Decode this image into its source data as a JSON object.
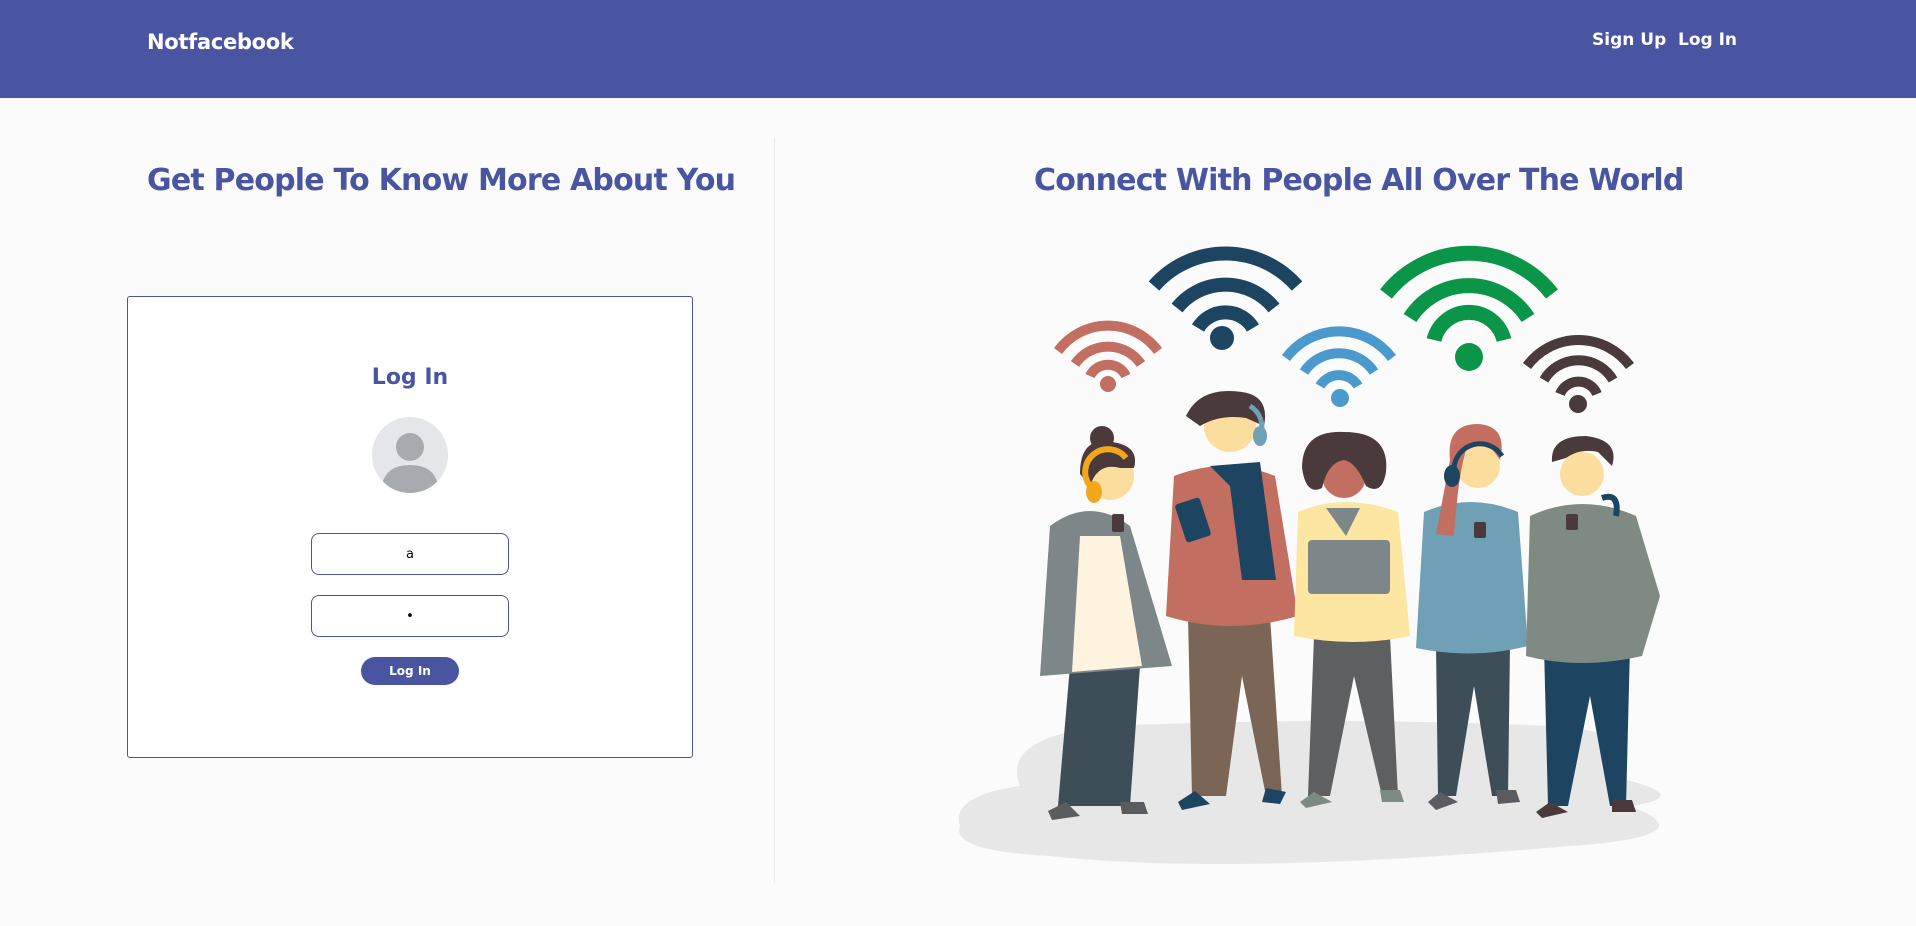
{
  "navbar": {
    "brand": "Notfacebook",
    "signup_label": "Sign Up",
    "login_label": "Log In",
    "background": "#4a55a2"
  },
  "left": {
    "title": "Get People To Know More About You"
  },
  "login_card": {
    "title": "Log In",
    "username_value": "a",
    "password_value": "•",
    "button_label": "Log In"
  },
  "right": {
    "title": "Connect With People All Over The World"
  },
  "colors": {
    "accent": "#4a55a2",
    "wifi_navy": "#1d4461",
    "wifi_green": "#0a9548",
    "wifi_blue": "#4a9acd",
    "wifi_coral": "#c26e61",
    "wifi_brown": "#4a3a3b"
  },
  "icons": {
    "avatar": "default-user-avatar-icon",
    "illustration": "people-with-wifi-illustration"
  }
}
